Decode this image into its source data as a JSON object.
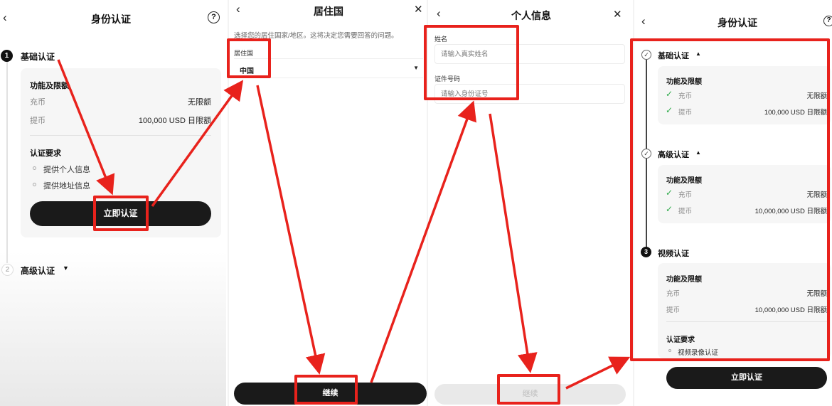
{
  "screen1": {
    "title": "身份认证",
    "step1": {
      "number": "1",
      "label": "基础认证"
    },
    "features_title": "功能及限额",
    "deposit_label": "充币",
    "deposit_value": "无限额",
    "withdraw_label": "提币",
    "withdraw_value": "100,000 USD 日限额",
    "requirements_title": "认证要求",
    "requirements": [
      "提供个人信息",
      "提供地址信息"
    ],
    "verify_button": "立即认证",
    "step2": {
      "number": "2",
      "label": "高级认证"
    }
  },
  "screen2": {
    "title": "居住国",
    "description": "选择您的居住国家/地区。这将决定您需要回答的问题。",
    "country_label": "居住国",
    "country_value": "中国",
    "continue_button": "继续"
  },
  "screen3": {
    "title": "个人信息",
    "name_label": "姓名",
    "name_placeholder": "请输入真实姓名",
    "id_label": "证件号码",
    "id_placeholder": "请输入身份证号",
    "continue_button": "继续"
  },
  "screen4": {
    "title": "身份认证",
    "basic": {
      "label": "基础认证",
      "features_title": "功能及限额",
      "deposit_label": "充币",
      "deposit_value": "无限额",
      "withdraw_label": "提币",
      "withdraw_value": "100,000 USD 日限额"
    },
    "advanced": {
      "label": "高级认证",
      "features_title": "功能及限额",
      "deposit_label": "充币",
      "deposit_value": "无限额",
      "withdraw_label": "提币",
      "withdraw_value": "10,000,000 USD 日限额"
    },
    "video": {
      "number": "3",
      "label": "视频认证",
      "features_title": "功能及限额",
      "deposit_label": "充币",
      "deposit_value": "无限额",
      "withdraw_label": "提币",
      "withdraw_value": "10,000,000 USD 日限额",
      "requirements_title": "认证要求",
      "requirement": "视频录像认证"
    },
    "verify_button": "立即认证"
  },
  "colors": {
    "highlight": "#e8221c",
    "check": "#2eab4a",
    "button_dark": "#1a1a1a"
  }
}
